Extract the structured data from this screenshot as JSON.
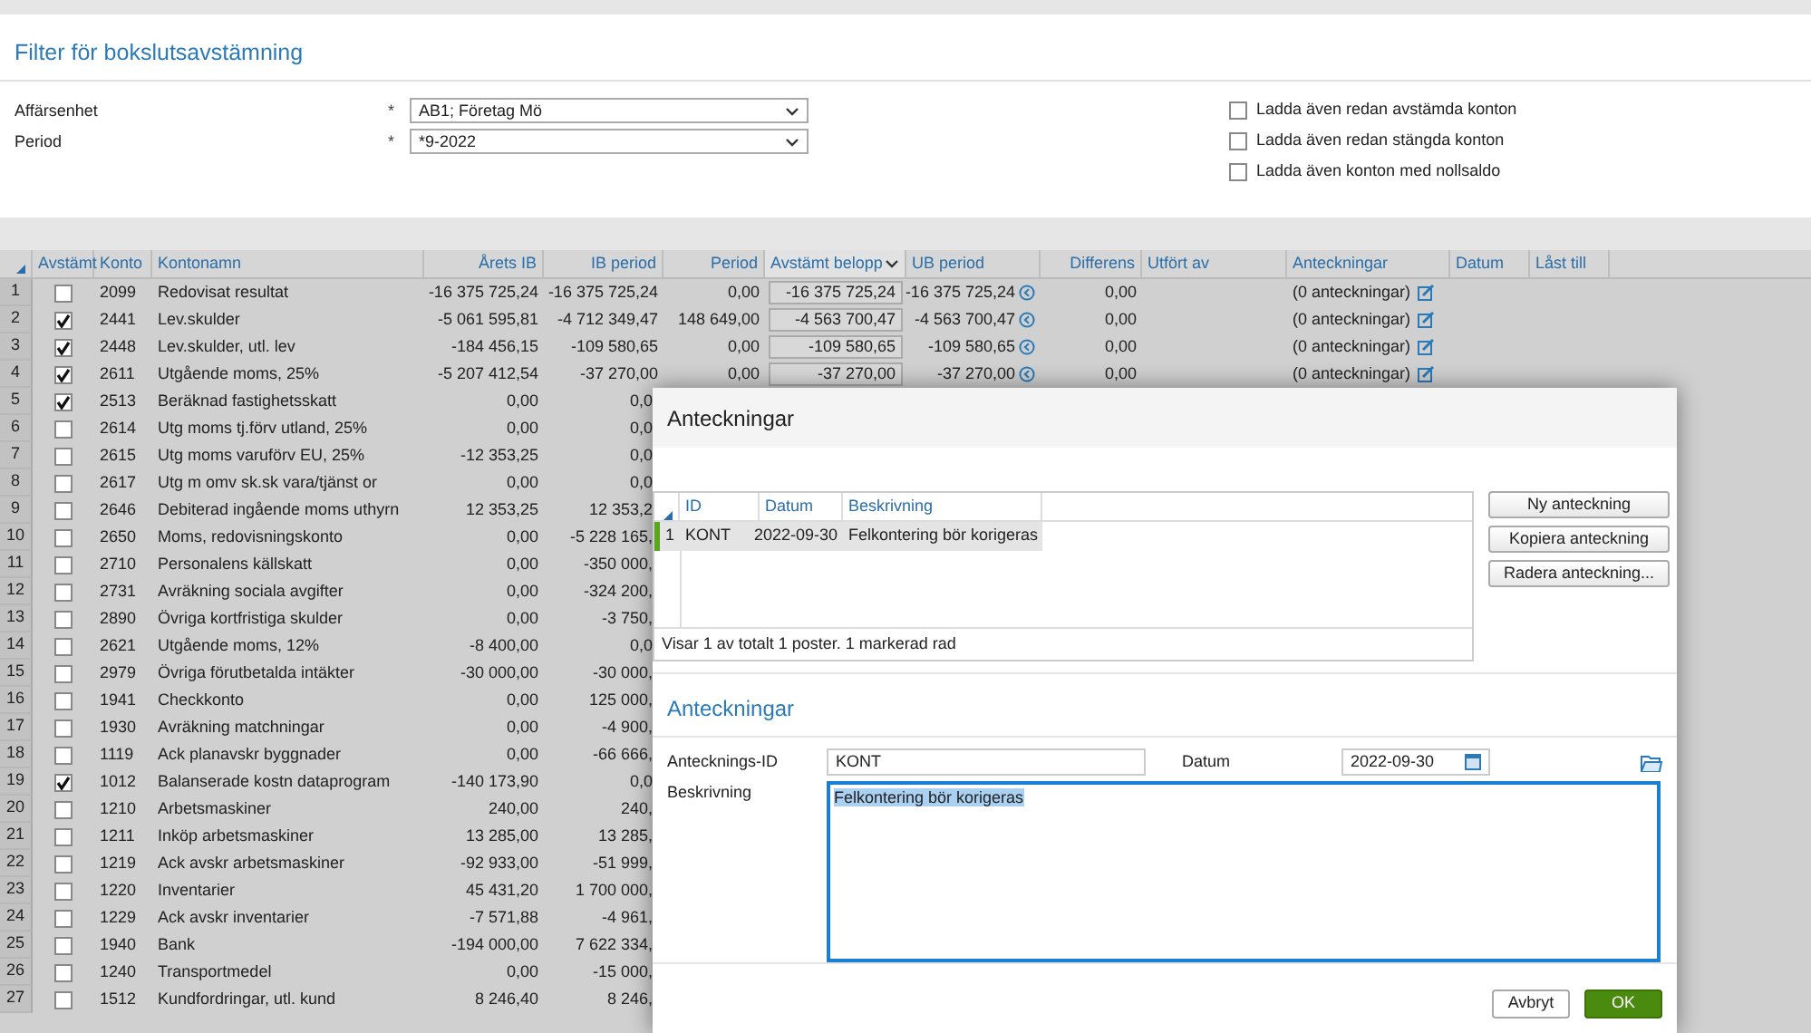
{
  "filter": {
    "title": "Filter för bokslutsavstämning",
    "fields": [
      {
        "label": "Affärsenhet",
        "marker": "*",
        "value": "AB1; Företag Mö"
      },
      {
        "label": "Period",
        "marker": "*",
        "value": "*9-2022"
      }
    ],
    "options": [
      {
        "label": "Ladda även redan avstämda konton",
        "checked": false
      },
      {
        "label": "Ladda även redan stängda konton",
        "checked": false
      },
      {
        "label": "Ladda även konton med nollsaldo",
        "checked": false
      }
    ]
  },
  "table": {
    "columns": [
      "Avstämt",
      "Konto",
      "Kontonamn",
      "Årets IB",
      "IB period",
      "Period",
      "Avstämt belopp",
      "UB period",
      "Differens",
      "Utfört av",
      "Anteckningar",
      "Datum",
      "Låst till"
    ],
    "rows": [
      {
        "num": "1",
        "checked": false,
        "konto": "2099",
        "name": "Redovisat resultat",
        "arets_ib": "-16 375 725,24",
        "ib_period": "-16 375 725,24",
        "period": "0,00",
        "avstamt_belopp": "-16 375 725,24",
        "ub_period": "-16 375 725,24",
        "differens": "0,00",
        "anteckningar": "(0 anteckningar)"
      },
      {
        "num": "2",
        "checked": true,
        "konto": "2441",
        "name": "Lev.skulder",
        "arets_ib": "-5 061 595,81",
        "ib_period": "-4 712 349,47",
        "period": "148 649,00",
        "avstamt_belopp": "-4 563 700,47",
        "ub_period": "-4 563 700,47",
        "differens": "0,00",
        "anteckningar": "(0 anteckningar)"
      },
      {
        "num": "3",
        "checked": true,
        "konto": "2448",
        "name": "Lev.skulder, utl. lev",
        "arets_ib": "-184 456,15",
        "ib_period": "-109 580,65",
        "period": "0,00",
        "avstamt_belopp": "-109 580,65",
        "ub_period": "-109 580,65",
        "differens": "0,00",
        "anteckningar": "(0 anteckningar)"
      },
      {
        "num": "4",
        "checked": true,
        "konto": "2611",
        "name": "Utgående moms, 25%",
        "arets_ib": "-5 207 412,54",
        "ib_period": "-37 270,00",
        "period": "0,00",
        "avstamt_belopp": "-37 270,00",
        "ub_period": "-37 270,00",
        "differens": "0,00",
        "anteckningar": "(0 anteckningar)"
      },
      {
        "num": "5",
        "checked": true,
        "konto": "2513",
        "name": "Beräknad fastighetsskatt",
        "arets_ib": "0,00",
        "ib_period": "0,0"
      },
      {
        "num": "6",
        "checked": false,
        "konto": "2614",
        "name": "Utg moms tj.förv utland, 25%",
        "arets_ib": "0,00",
        "ib_period": "0,0"
      },
      {
        "num": "7",
        "checked": false,
        "konto": "2615",
        "name": "Utg moms varuförv EU, 25%",
        "arets_ib": "-12 353,25",
        "ib_period": "0,0"
      },
      {
        "num": "8",
        "checked": false,
        "konto": "2617",
        "name": "Utg m omv sk.sk vara/tjänst or",
        "arets_ib": "0,00",
        "ib_period": "0,0"
      },
      {
        "num": "9",
        "checked": false,
        "konto": "2646",
        "name": "Debiterad ingående moms uthyrn",
        "arets_ib": "12 353,25",
        "ib_period": "12 353,2"
      },
      {
        "num": "10",
        "checked": false,
        "konto": "2650",
        "name": "Moms, redovisningskonto",
        "arets_ib": "0,00",
        "ib_period": "-5 228 165,"
      },
      {
        "num": "11",
        "checked": false,
        "konto": "2710",
        "name": "Personalens källskatt",
        "arets_ib": "0,00",
        "ib_period": "-350 000,"
      },
      {
        "num": "12",
        "checked": false,
        "konto": "2731",
        "name": "Avräkning sociala avgifter",
        "arets_ib": "0,00",
        "ib_period": "-324 200,"
      },
      {
        "num": "13",
        "checked": false,
        "konto": "2890",
        "name": "Övriga kortfristiga skulder",
        "arets_ib": "0,00",
        "ib_period": "-3 750,"
      },
      {
        "num": "14",
        "checked": false,
        "konto": "2621",
        "name": "Utgående moms, 12%",
        "arets_ib": "-8 400,00",
        "ib_period": "0,0"
      },
      {
        "num": "15",
        "checked": false,
        "konto": "2979",
        "name": "Övriga förutbetalda intäkter",
        "arets_ib": "-30 000,00",
        "ib_period": "-30 000,"
      },
      {
        "num": "16",
        "checked": false,
        "konto": "1941",
        "name": "Checkkonto",
        "arets_ib": "0,00",
        "ib_period": "125 000,"
      },
      {
        "num": "17",
        "checked": false,
        "konto": "1930",
        "name": "Avräkning matchningar",
        "arets_ib": "0,00",
        "ib_period": "-4 900,"
      },
      {
        "num": "18",
        "checked": false,
        "konto": "1119",
        "name": "Ack planavskr byggnader",
        "arets_ib": "0,00",
        "ib_period": "-66 666,"
      },
      {
        "num": "19",
        "checked": true,
        "konto": "1012",
        "name": "Balanserade kostn dataprogram",
        "arets_ib": "-140 173,90",
        "ib_period": "0,0"
      },
      {
        "num": "20",
        "checked": false,
        "konto": "1210",
        "name": "Arbetsmaskiner",
        "arets_ib": "240,00",
        "ib_period": "240,"
      },
      {
        "num": "21",
        "checked": false,
        "konto": "1211",
        "name": "Inköp arbetsmaskiner",
        "arets_ib": "13 285,00",
        "ib_period": "13 285,"
      },
      {
        "num": "22",
        "checked": false,
        "konto": "1219",
        "name": "Ack avskr arbetsmaskiner",
        "arets_ib": "-92 933,00",
        "ib_period": "-51 999,"
      },
      {
        "num": "23",
        "checked": false,
        "konto": "1220",
        "name": "Inventarier",
        "arets_ib": "45 431,20",
        "ib_period": "1 700 000,"
      },
      {
        "num": "24",
        "checked": false,
        "konto": "1229",
        "name": "Ack avskr inventarier",
        "arets_ib": "-7 571,88",
        "ib_period": "-4 961,"
      },
      {
        "num": "25",
        "checked": false,
        "konto": "1940",
        "name": "Bank",
        "arets_ib": "-194 000,00",
        "ib_period": "7 622 334,"
      },
      {
        "num": "26",
        "checked": false,
        "konto": "1240",
        "name": "Transportmedel",
        "arets_ib": "0,00",
        "ib_period": "-15 000,"
      },
      {
        "num": "27",
        "checked": false,
        "konto": "1512",
        "name": "Kundfordringar, utl. kund",
        "arets_ib": "8 246,40",
        "ib_period": "8 246,"
      }
    ]
  },
  "dialog": {
    "title": "Anteckningar",
    "grid": {
      "columns": [
        "ID",
        "Datum",
        "Beskrivning"
      ],
      "rows": [
        {
          "num": "1",
          "id": "KONT",
          "datum": "2022-09-30",
          "beskrivning": "Felkontering bör korigeras",
          "selected": true
        }
      ],
      "status": "Visar 1 av totalt 1 poster. 1 markerad rad"
    },
    "buttons": [
      "Ny anteckning",
      "Kopiera anteckning",
      "Radera anteckning..."
    ],
    "section_title": "Anteckningar",
    "form": {
      "id_label": "Antecknings-ID",
      "id_value": "KONT",
      "date_label": "Datum",
      "date_value": "2022-09-30",
      "desc_label": "Beskrivning",
      "desc_value": "Felkontering bör korigeras"
    },
    "cancel": "Avbryt",
    "ok": "OK"
  }
}
